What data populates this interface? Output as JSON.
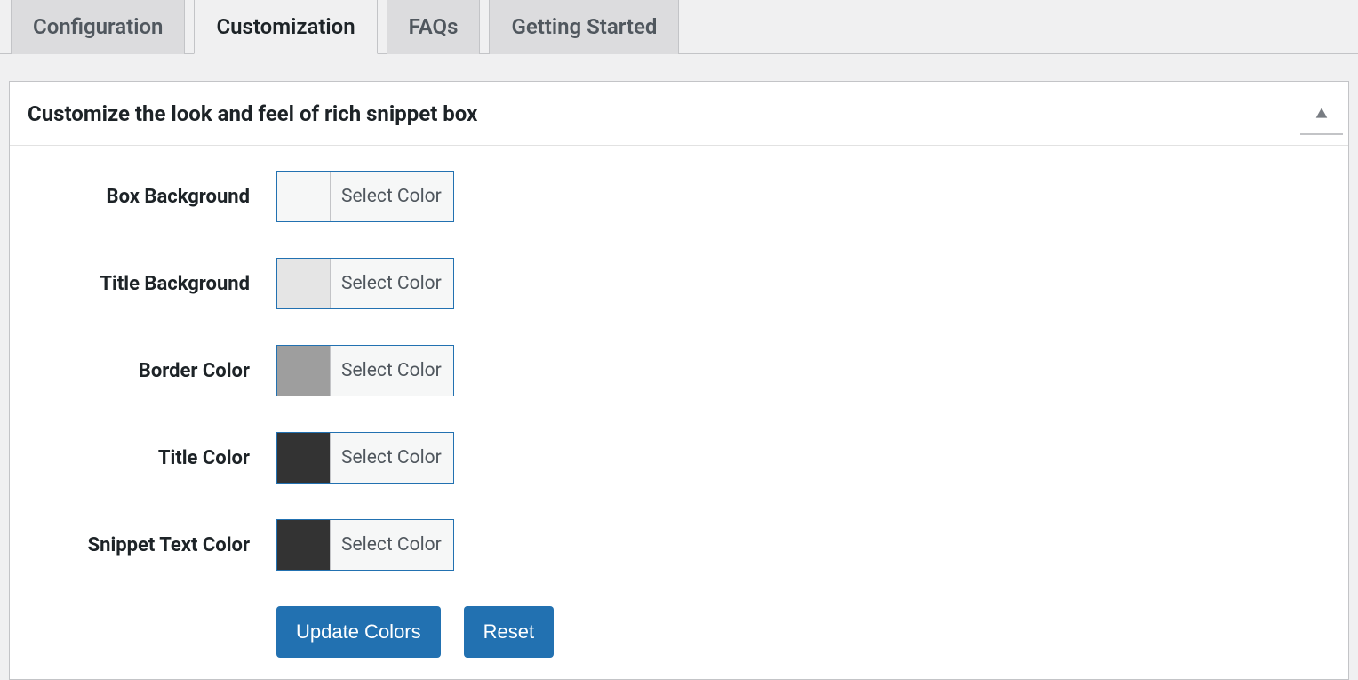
{
  "tabs": [
    {
      "label": "Configuration",
      "active": false
    },
    {
      "label": "Customization",
      "active": true
    },
    {
      "label": "FAQs",
      "active": false
    },
    {
      "label": "Getting Started",
      "active": false
    }
  ],
  "panel": {
    "title": "Customize the look and feel of rich snippet box"
  },
  "color_button_label": "Select Color",
  "fields": [
    {
      "label": "Box Background",
      "swatch": "#f6f7f7"
    },
    {
      "label": "Title Background",
      "swatch": "#e5e5e5"
    },
    {
      "label": "Border Color",
      "swatch": "#9e9e9e"
    },
    {
      "label": "Title Color",
      "swatch": "#333333"
    },
    {
      "label": "Snippet Text Color",
      "swatch": "#333333"
    }
  ],
  "buttons": {
    "update": "Update Colors",
    "reset": "Reset"
  }
}
